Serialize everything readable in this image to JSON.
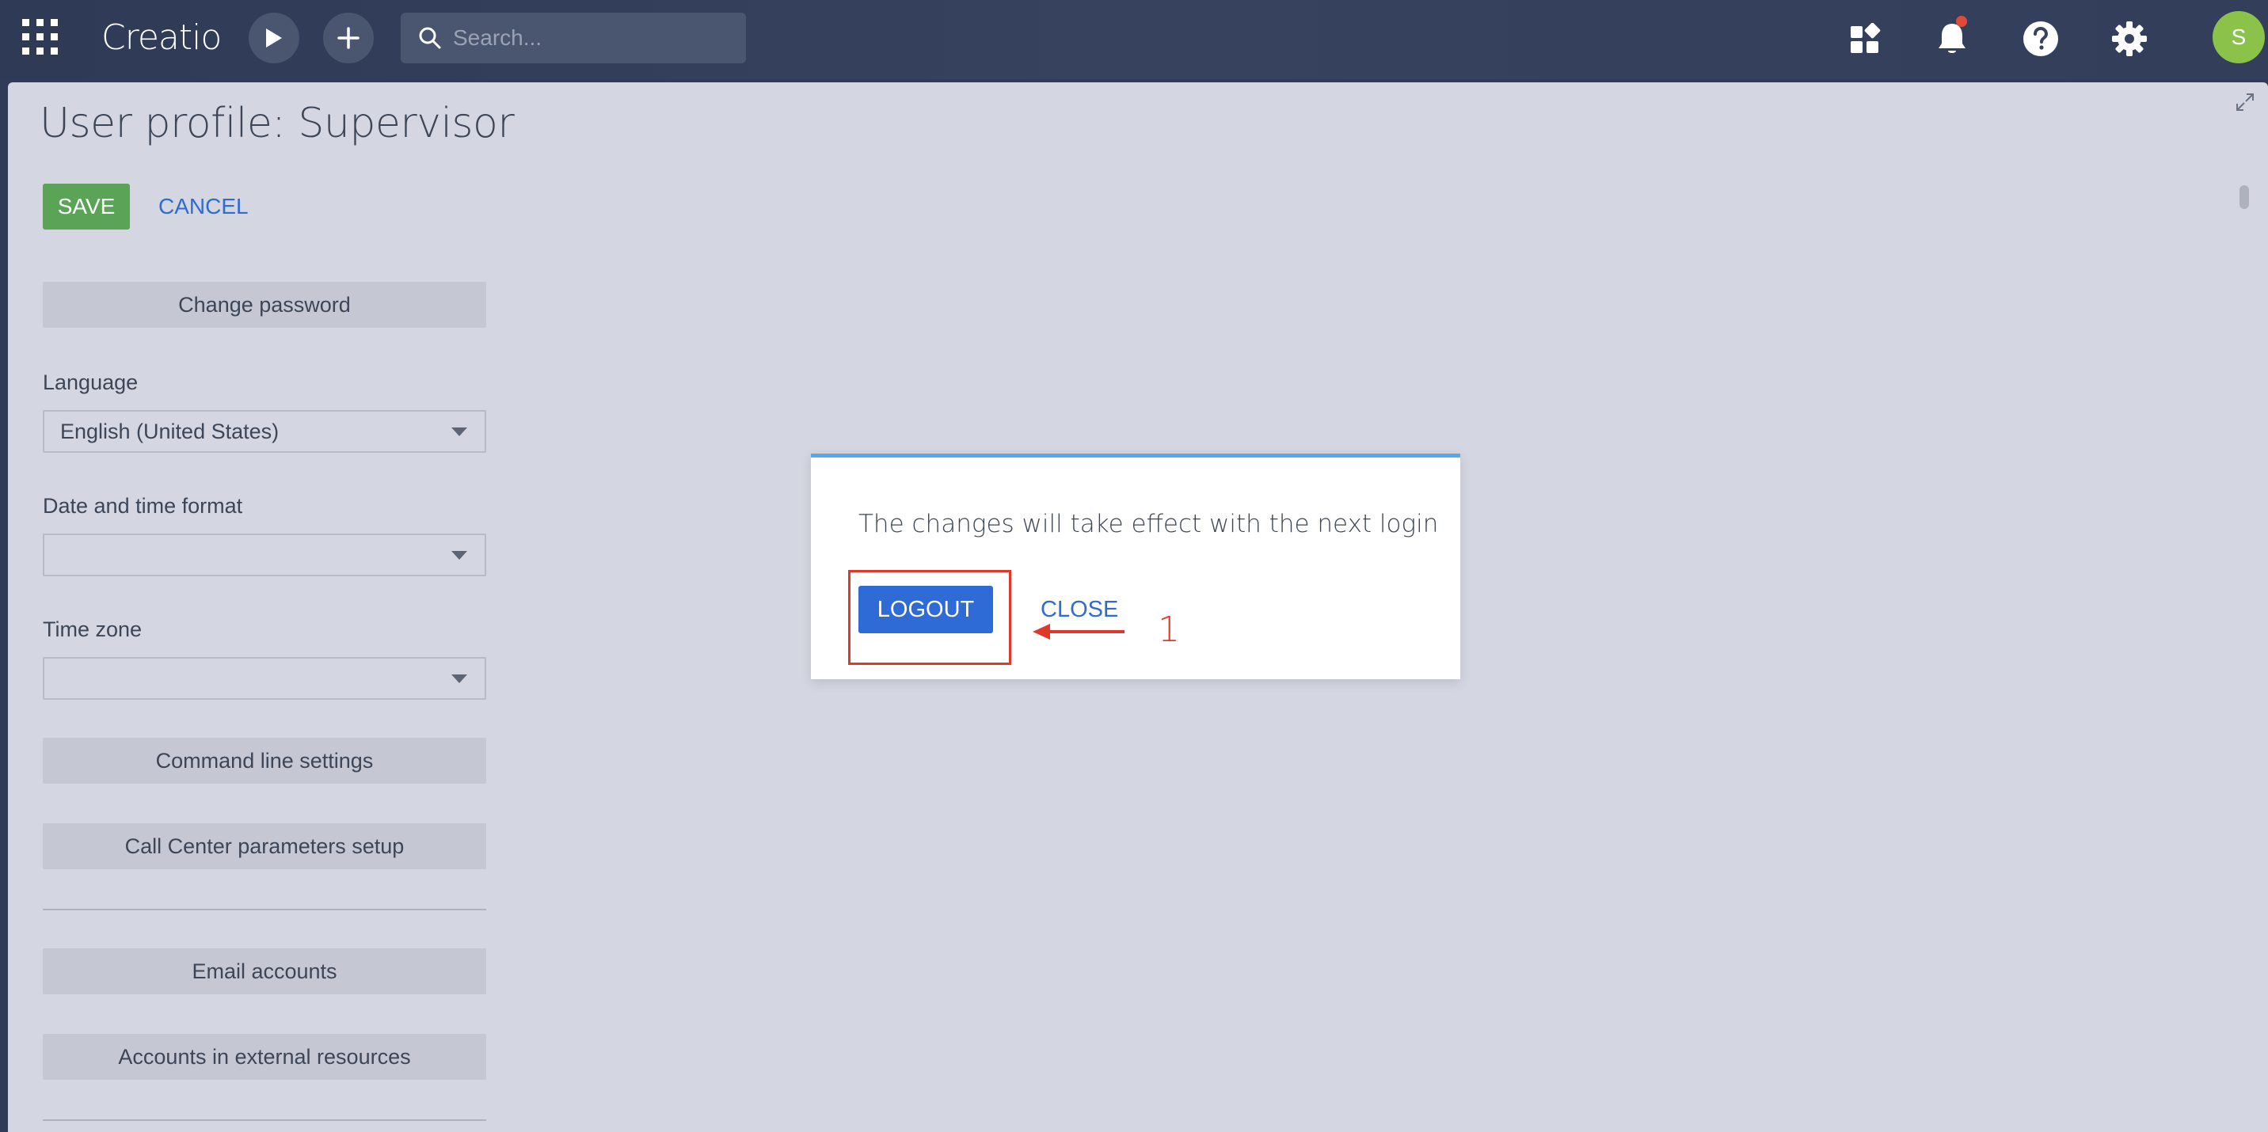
{
  "topbar": {
    "logo": "Creatio",
    "search_placeholder": "Search...",
    "avatar_initial": "S"
  },
  "page": {
    "title": "User profile: Supervisor",
    "save_label": "SAVE",
    "cancel_label": "CANCEL",
    "change_password_label": "Change password",
    "language_label": "Language",
    "language_value": "English (United States)",
    "date_format_label": "Date and time format",
    "date_format_value": "",
    "time_zone_label": "Time zone",
    "time_zone_value": "",
    "command_line_label": "Command line settings",
    "call_center_label": "Call Center parameters setup",
    "email_accounts_label": "Email accounts",
    "external_accounts_label": "Accounts in external resources"
  },
  "dialog": {
    "message": "The changes will take effect with the next login",
    "logout_label": "LOGOUT",
    "close_label": "CLOSE"
  },
  "annotation": {
    "number": "1",
    "color": "#e0392b"
  },
  "colors": {
    "primary_blue": "#2f6bd6",
    "save_green": "#5ba356",
    "dialog_accent": "#5aa7e8",
    "avatar_green": "#8bc34a"
  }
}
